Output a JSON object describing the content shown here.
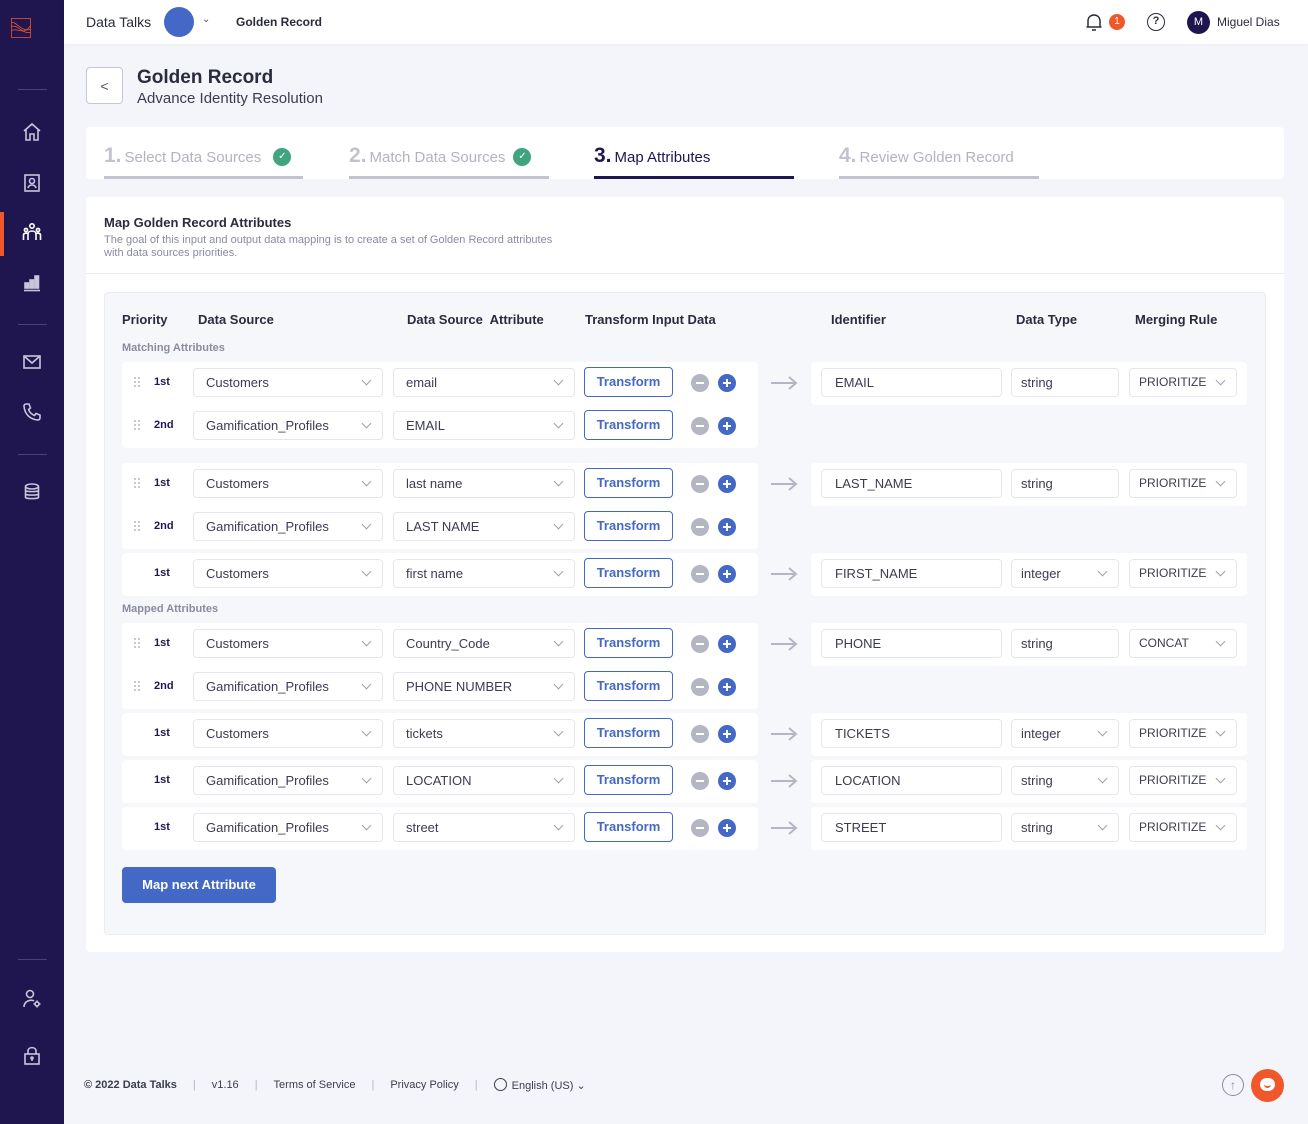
{
  "topbar": {
    "brand": "Data Talks",
    "breadcrumb": "Golden Record",
    "notification_count": "1",
    "help_label": "?",
    "user_initial": "M",
    "user_name": "Miguel Dias"
  },
  "sidebar": {
    "items": [
      {
        "name": "home",
        "icon": "home-icon"
      },
      {
        "name": "contacts",
        "icon": "contact-card-icon"
      },
      {
        "name": "audiences",
        "icon": "users-group-icon",
        "active": true
      },
      {
        "name": "analytics",
        "icon": "bar-chart-icon"
      },
      {
        "name": "email",
        "icon": "mail-icon"
      },
      {
        "name": "phone",
        "icon": "phone-icon"
      },
      {
        "name": "database",
        "icon": "database-icon"
      },
      {
        "name": "user-settings",
        "icon": "user-gear-icon"
      },
      {
        "name": "security",
        "icon": "lock-icon"
      }
    ]
  },
  "header": {
    "back_label": "<",
    "title": "Golden Record",
    "subtitle": "Advance Identity Resolution"
  },
  "steps": [
    {
      "num": "1.",
      "label": "Select Data Sources",
      "status": "done",
      "check": "✓"
    },
    {
      "num": "2.",
      "label": "Match Data Sources",
      "status": "done",
      "check": "✓"
    },
    {
      "num": "3.",
      "label": "Map Attributes",
      "status": "active"
    },
    {
      "num": "4.",
      "label": "Review Golden Record",
      "status": "pending"
    }
  ],
  "card": {
    "title": "Map Golden Record Attributes",
    "description": "The goal of this input and output data mapping is to create a set of Golden Record attributes with data sources priorities."
  },
  "table": {
    "headers": {
      "priority": "Priority",
      "data_source": "Data Source",
      "attribute": "Data Source  Attribute",
      "transform": "Transform Input Data",
      "identifier": "Identifier",
      "data_type": "Data Type",
      "merging_rule": "Merging Rule"
    },
    "sections": {
      "matching": "Matching Attributes",
      "mapped": "Mapped Attributes"
    },
    "transform_label": "Transform",
    "groups": [
      {
        "rows": [
          {
            "priority": "1st",
            "source": "Customers",
            "attribute": "email"
          },
          {
            "priority": "2nd",
            "source": "Gamification_Profiles",
            "attribute": "EMAIL"
          }
        ],
        "identifier": "EMAIL",
        "data_type": "string",
        "merging_rule": "PRIORITIZE"
      },
      {
        "rows": [
          {
            "priority": "1st",
            "source": "Customers",
            "attribute": "last name"
          },
          {
            "priority": "2nd",
            "source": "Gamification_Profiles",
            "attribute": "LAST NAME"
          }
        ],
        "identifier": "LAST_NAME",
        "data_type": "string",
        "merging_rule": "PRIORITIZE"
      },
      {
        "rows": [
          {
            "priority": "1st",
            "source": "Customers",
            "attribute": "first name"
          }
        ],
        "identifier": "FIRST_NAME",
        "data_type": "integer",
        "merging_rule": "PRIORITIZE"
      },
      {
        "rows": [
          {
            "priority": "1st",
            "source": "Customers",
            "attribute": "Country_Code"
          },
          {
            "priority": "2nd",
            "source": "Gamification_Profiles",
            "attribute": "PHONE NUMBER"
          }
        ],
        "identifier": "PHONE",
        "data_type": "string",
        "merging_rule": "CONCAT"
      },
      {
        "rows": [
          {
            "priority": "1st",
            "source": "Customers",
            "attribute": "tickets"
          }
        ],
        "identifier": "TICKETS",
        "data_type": "integer",
        "merging_rule": "PRIORITIZE"
      },
      {
        "rows": [
          {
            "priority": "1st",
            "source": "Gamification_Profiles",
            "attribute": "LOCATION"
          }
        ],
        "identifier": "LOCATION",
        "data_type": "string",
        "merging_rule": "PRIORITIZE"
      },
      {
        "rows": [
          {
            "priority": "1st",
            "source": "Gamification_Profiles",
            "attribute": "street"
          }
        ],
        "identifier": "STREET",
        "data_type": "string",
        "merging_rule": "PRIORITIZE"
      }
    ],
    "map_next_label": "Map next Attribute"
  },
  "footer": {
    "copyright": "© 2022 Data Talks",
    "version": "v1.16",
    "terms": "Terms of Service",
    "privacy": "Privacy Policy",
    "language": "English (US)",
    "scroll_top": "↑"
  },
  "colors": {
    "sidebar": "#1f1650",
    "accent": "#4468c6",
    "brand_orange": "#f0572a",
    "success": "#3fa57e"
  }
}
